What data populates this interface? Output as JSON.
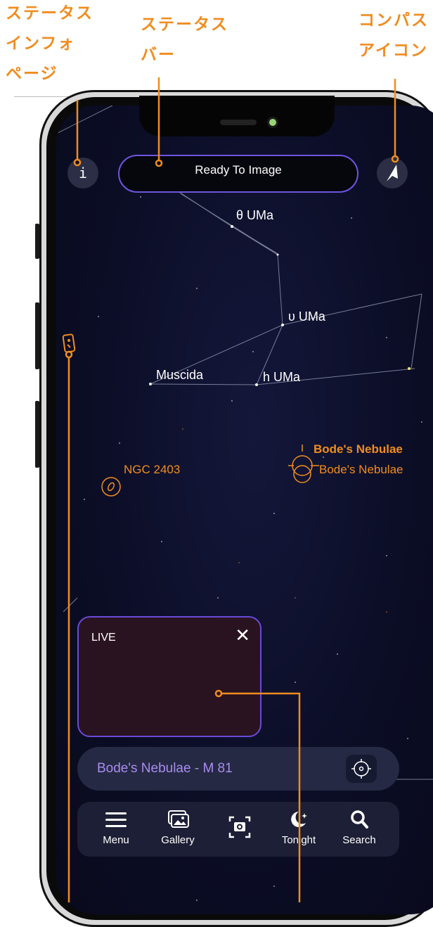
{
  "annotations": {
    "status_info_page": [
      "ステータス",
      "インフォ",
      "ページ"
    ],
    "status_bar": [
      "ステータス",
      "バー"
    ],
    "compass_icon": [
      "コンパス",
      "アイコン"
    ]
  },
  "status_bar": {
    "text": "Ready To Image"
  },
  "info_button": {
    "label": "i"
  },
  "sky": {
    "stars": [
      "θ UMa",
      "υ UMa",
      "Muscida",
      "h UMa"
    ],
    "objects": [
      "NGC 2403",
      "Bode's Nebulae",
      "Bode's Nebulae"
    ]
  },
  "live_panel": {
    "label": "LIVE",
    "close": "✕"
  },
  "target": {
    "name": "Bode's Nebulae - M 81"
  },
  "tabbar": {
    "items": [
      "Menu",
      "Gallery",
      "",
      "Tonight",
      "Search"
    ]
  },
  "colors": {
    "accent_orange": "#f08c1f",
    "accent_purple": "#6f55e0",
    "sky": "#0b0d25"
  }
}
